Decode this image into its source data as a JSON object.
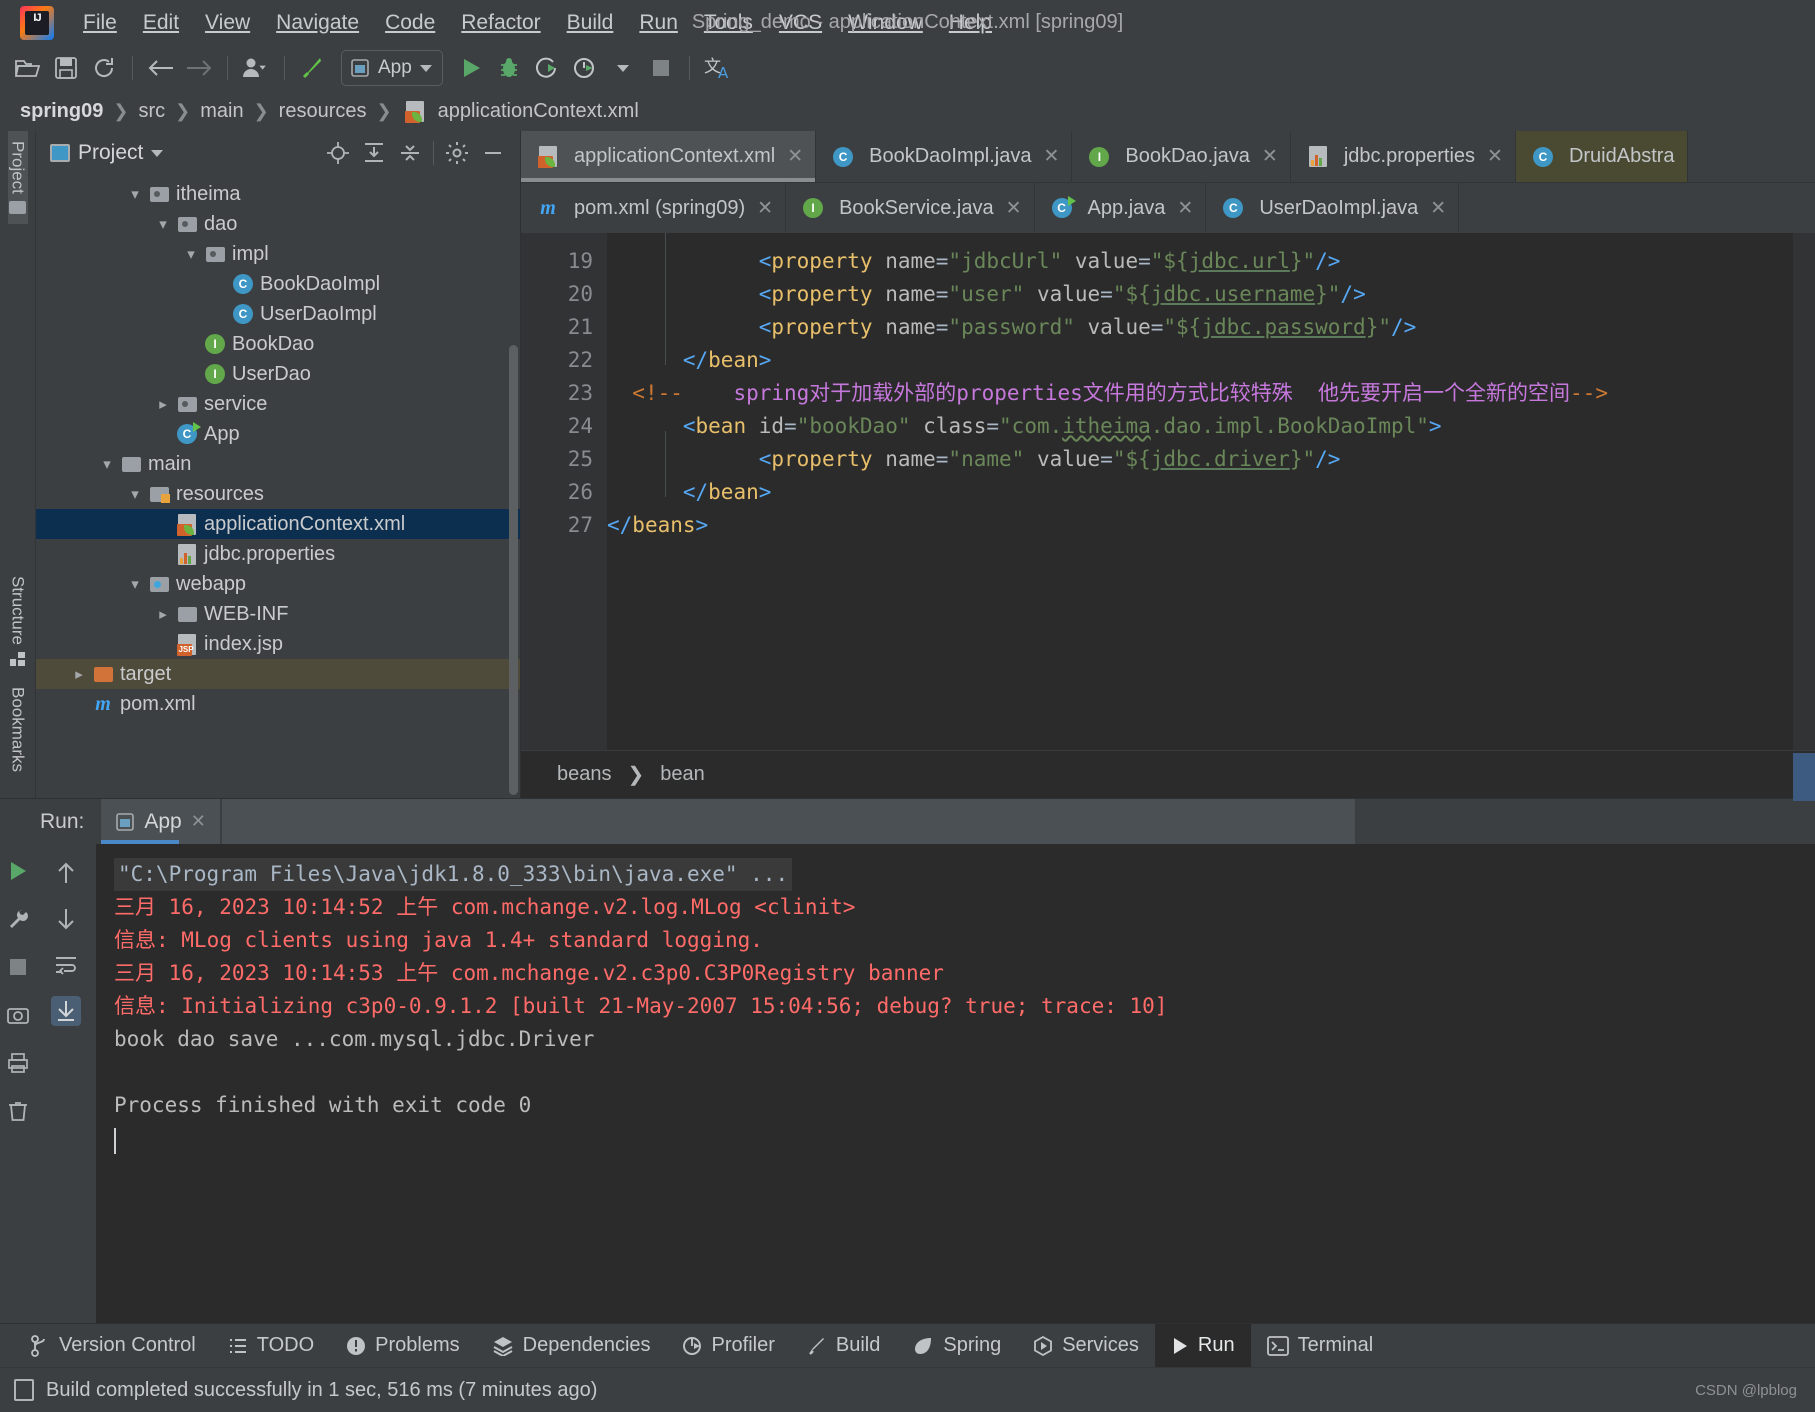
{
  "window": {
    "title": "Spring_demo - applicationContext.xml [spring09]"
  },
  "menu": {
    "items": [
      {
        "label": "File"
      },
      {
        "label": "Edit"
      },
      {
        "label": "View"
      },
      {
        "label": "Navigate"
      },
      {
        "label": "Code"
      },
      {
        "label": "Refactor"
      },
      {
        "label": "Build"
      },
      {
        "label": "Run"
      },
      {
        "label": "Tools"
      },
      {
        "label": "VCS"
      },
      {
        "label": "Window"
      },
      {
        "label": "Help"
      }
    ]
  },
  "toolbar": {
    "run_config": "App",
    "icons": [
      "open-folder-icon",
      "save-icon",
      "sync-icon",
      "back-arrow-icon",
      "forward-arrow-icon",
      "profile-dropdown-icon",
      "build-hammer-icon",
      "run-icon",
      "debug-icon",
      "run-with-coverage-icon",
      "profiler-icon",
      "stop-icon",
      "translate-icon"
    ]
  },
  "breadcrumb": {
    "items": [
      "spring09",
      "src",
      "main",
      "resources",
      "applicationContext.xml"
    ]
  },
  "left_rail": {
    "top_tab": "Project",
    "bottom_tabs": [
      "Structure",
      "Bookmarks"
    ]
  },
  "project_panel": {
    "title": "Project",
    "toolbar_icons": [
      "locate-target-icon",
      "expand-all-icon",
      "collapse-all-icon",
      "gear-icon",
      "hide-icon"
    ],
    "tree": [
      {
        "label": "itheima",
        "indent": 4,
        "arrow": "down",
        "icon": "package-folder-icon"
      },
      {
        "label": "dao",
        "indent": 5,
        "arrow": "down",
        "icon": "package-folder-icon"
      },
      {
        "label": "impl",
        "indent": 6,
        "arrow": "down",
        "icon": "package-folder-icon"
      },
      {
        "label": "BookDaoImpl",
        "indent": 7,
        "arrow": "none",
        "icon": "class-icon"
      },
      {
        "label": "UserDaoImpl",
        "indent": 7,
        "arrow": "none",
        "icon": "class-icon"
      },
      {
        "label": "BookDao",
        "indent": 6,
        "arrow": "none",
        "icon": "interface-icon"
      },
      {
        "label": "UserDao",
        "indent": 6,
        "arrow": "none",
        "icon": "interface-icon"
      },
      {
        "label": "service",
        "indent": 5,
        "arrow": "right",
        "icon": "package-folder-icon"
      },
      {
        "label": "App",
        "indent": 5,
        "arrow": "none",
        "icon": "runnable-class-icon"
      },
      {
        "label": "main",
        "indent": 3,
        "arrow": "down",
        "icon": "folder-icon"
      },
      {
        "label": "resources",
        "indent": 4,
        "arrow": "down",
        "icon": "resources-folder-icon"
      },
      {
        "label": "applicationContext.xml",
        "indent": 5,
        "arrow": "none",
        "icon": "spring-xml-icon",
        "selected": true
      },
      {
        "label": "jdbc.properties",
        "indent": 5,
        "arrow": "none",
        "icon": "properties-icon"
      },
      {
        "label": "webapp",
        "indent": 4,
        "arrow": "down",
        "icon": "webapp-folder-icon"
      },
      {
        "label": "WEB-INF",
        "indent": 5,
        "arrow": "right",
        "icon": "folder-icon"
      },
      {
        "label": "index.jsp",
        "indent": 5,
        "arrow": "none",
        "icon": "jsp-icon"
      },
      {
        "label": "target",
        "indent": 2,
        "arrow": "right",
        "icon": "excluded-folder-icon",
        "highlight": true
      },
      {
        "label": "pom.xml",
        "indent": 2,
        "arrow": "none",
        "icon": "maven-icon"
      }
    ]
  },
  "editor_tabs": {
    "row1": [
      {
        "label": "applicationContext.xml",
        "icon": "spring-xml-icon",
        "active": true,
        "closable": true
      },
      {
        "label": "BookDaoImpl.java",
        "icon": "class-icon",
        "closable": true
      },
      {
        "label": "BookDao.java",
        "icon": "interface-icon",
        "closable": true
      },
      {
        "label": "jdbc.properties",
        "icon": "properties-icon",
        "closable": true
      },
      {
        "label": "DruidAbstra",
        "icon": "class-icon",
        "closable": false,
        "olive": true
      }
    ],
    "row2": [
      {
        "label": "pom.xml (spring09)",
        "icon": "maven-icon",
        "closable": true
      },
      {
        "label": "BookService.java",
        "icon": "interface-icon",
        "closable": true
      },
      {
        "label": "App.java",
        "icon": "runnable-class-icon",
        "closable": true
      },
      {
        "label": "UserDaoImpl.java",
        "icon": "class-icon",
        "closable": true
      }
    ]
  },
  "editor": {
    "first_line_number": 19,
    "lines": [
      {
        "num": 19,
        "fold": "",
        "html": "            <span class=\"brk\">&lt;</span><span class=\"tagc\">property</span> <span class=\"attr\">name</span>=<span class=\"str\">\"jdbcUrl\"</span> <span class=\"attr\">value</span>=<span class=\"str\">\"${</span><span class=\"str ul\">jdbc.url</span><span class=\"str\">}\"</span><span class=\"brk\">/&gt;</span>"
      },
      {
        "num": 20,
        "fold": "",
        "html": "            <span class=\"brk\">&lt;</span><span class=\"tagc\">property</span> <span class=\"attr\">name</span>=<span class=\"str\">\"user\"</span> <span class=\"attr\">value</span>=<span class=\"str\">\"${</span><span class=\"str ul\">jdbc.username</span><span class=\"str\">}\"</span><span class=\"brk\">/&gt;</span>"
      },
      {
        "num": 21,
        "fold": "",
        "html": "            <span class=\"brk\">&lt;</span><span class=\"tagc\">property</span> <span class=\"attr\">name</span>=<span class=\"str\">\"password\"</span> <span class=\"attr\">value</span>=<span class=\"str\">\"${</span><span class=\"str ul\">jdbc.password</span><span class=\"str\">}\"</span><span class=\"brk\">/&gt;</span>"
      },
      {
        "num": 22,
        "fold": "collapse",
        "html": "      <span class=\"brk\">&lt;/</span><span class=\"tagc\">bean</span><span class=\"brk\">&gt;</span>"
      },
      {
        "num": 23,
        "fold": "",
        "html": "  <span class=\"cmt\">&lt;!--</span>    <span class=\"cmttext\">spring对于加载外部的properties文件用的方式比较特殊  他先要开启一个全新的空间</span><span class=\"cmt\">--&gt;</span>"
      },
      {
        "num": 24,
        "fold": "expand",
        "html": "      <span class=\"brk\">&lt;</span><span class=\"tagc\">bean</span> <span class=\"attr\">id</span>=<span class=\"str\">\"bookDao\"</span> <span class=\"attr\">class</span>=<span class=\"str\">\"com.</span><span class=\"str squig\">itheima</span><span class=\"str\">.dao.impl.BookDaoImpl\"</span><span class=\"brk\">&gt;</span>"
      },
      {
        "num": 25,
        "fold": "",
        "html": "            <span class=\"brk\">&lt;</span><span class=\"tagc\">property</span> <span class=\"attr\">name</span>=<span class=\"str\">\"name\"</span> <span class=\"attr\">value</span>=<span class=\"str\">\"${</span><span class=\"str ul\">jdbc.driver</span><span class=\"str\">}\"</span><span class=\"brk\">/&gt;</span>"
      },
      {
        "num": 26,
        "fold": "collapse",
        "html": "      <span class=\"brk\">&lt;/</span><span class=\"tagc\">bean</span><span class=\"brk\">&gt;</span>"
      },
      {
        "num": 27,
        "fold": "collapse",
        "html": "<span class=\"brk\">&lt;/</span><span class=\"tagc\">beans</span><span class=\"brk\">&gt;</span>"
      }
    ],
    "breadcrumb": [
      "beans",
      "bean"
    ]
  },
  "run_panel": {
    "label": "Run:",
    "tab": "App",
    "gutter_icons": [
      "run-icon",
      "wrench-icon",
      "stop-icon",
      "camera-icon",
      "print-icon",
      "trash-icon"
    ],
    "gutter2_icons": [
      "up-arrow-icon",
      "down-arrow-icon",
      "soft-wrap-icon",
      "scroll-to-end-icon"
    ],
    "console": [
      {
        "type": "cmd",
        "text": "\"C:\\Program Files\\Java\\jdk1.8.0_333\\bin\\java.exe\" ..."
      },
      {
        "type": "err",
        "text": "三月 16, 2023 10:14:52 上午 com.mchange.v2.log.MLog <clinit>"
      },
      {
        "type": "err",
        "text": "信息: MLog clients using java 1.4+ standard logging."
      },
      {
        "type": "err",
        "text": "三月 16, 2023 10:14:53 上午 com.mchange.v2.c3p0.C3P0Registry banner"
      },
      {
        "type": "err",
        "text": "信息: Initializing c3p0-0.9.1.2 [built 21-May-2007 15:04:56; debug? true; trace: 10]"
      },
      {
        "type": "out",
        "text": "book dao save ...com.mysql.jdbc.Driver"
      },
      {
        "type": "out",
        "text": ""
      },
      {
        "type": "out",
        "text": "Process finished with exit code 0"
      }
    ]
  },
  "tool_window_bar": {
    "items": [
      {
        "label": "Version Control",
        "icon": "branch-icon"
      },
      {
        "label": "TODO",
        "icon": "list-icon"
      },
      {
        "label": "Problems",
        "icon": "warning-icon"
      },
      {
        "label": "Dependencies",
        "icon": "layers-icon"
      },
      {
        "label": "Profiler",
        "icon": "profiler-icon"
      },
      {
        "label": "Build",
        "icon": "hammer-icon"
      },
      {
        "label": "Spring",
        "icon": "spring-leaf-icon"
      },
      {
        "label": "Services",
        "icon": "services-icon"
      },
      {
        "label": "Run",
        "icon": "run-icon",
        "active": true
      },
      {
        "label": "Terminal",
        "icon": "terminal-icon"
      }
    ]
  },
  "status_bar": {
    "message": "Build completed successfully in 1 sec, 516 ms (7 minutes ago)",
    "watermark": "CSDN @lpblog"
  },
  "colors": {
    "panel_bg": "#3c3f41",
    "editor_bg": "#2b2b2b",
    "selection_blue": "#0d2f4f",
    "accent_blue": "#4a88c7",
    "string_green": "#6a8759",
    "tag_yellow": "#e8bf6a",
    "comment_orange": "#cc7832",
    "error_red": "#ff6b68"
  }
}
